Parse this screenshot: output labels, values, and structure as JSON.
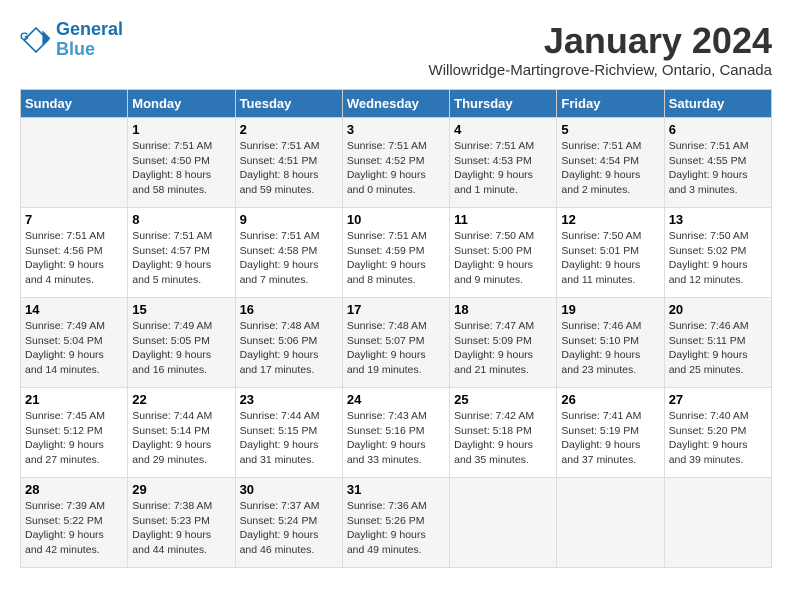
{
  "logo": {
    "line1": "General",
    "line2": "Blue"
  },
  "title": "January 2024",
  "subtitle": "Willowridge-Martingrove-Richview, Ontario, Canada",
  "days_of_week": [
    "Sunday",
    "Monday",
    "Tuesday",
    "Wednesday",
    "Thursday",
    "Friday",
    "Saturday"
  ],
  "weeks": [
    [
      {
        "day": "",
        "info": ""
      },
      {
        "day": "1",
        "info": "Sunrise: 7:51 AM\nSunset: 4:50 PM\nDaylight: 8 hours\nand 58 minutes."
      },
      {
        "day": "2",
        "info": "Sunrise: 7:51 AM\nSunset: 4:51 PM\nDaylight: 8 hours\nand 59 minutes."
      },
      {
        "day": "3",
        "info": "Sunrise: 7:51 AM\nSunset: 4:52 PM\nDaylight: 9 hours\nand 0 minutes."
      },
      {
        "day": "4",
        "info": "Sunrise: 7:51 AM\nSunset: 4:53 PM\nDaylight: 9 hours\nand 1 minute."
      },
      {
        "day": "5",
        "info": "Sunrise: 7:51 AM\nSunset: 4:54 PM\nDaylight: 9 hours\nand 2 minutes."
      },
      {
        "day": "6",
        "info": "Sunrise: 7:51 AM\nSunset: 4:55 PM\nDaylight: 9 hours\nand 3 minutes."
      }
    ],
    [
      {
        "day": "7",
        "info": "Sunrise: 7:51 AM\nSunset: 4:56 PM\nDaylight: 9 hours\nand 4 minutes."
      },
      {
        "day": "8",
        "info": "Sunrise: 7:51 AM\nSunset: 4:57 PM\nDaylight: 9 hours\nand 5 minutes."
      },
      {
        "day": "9",
        "info": "Sunrise: 7:51 AM\nSunset: 4:58 PM\nDaylight: 9 hours\nand 7 minutes."
      },
      {
        "day": "10",
        "info": "Sunrise: 7:51 AM\nSunset: 4:59 PM\nDaylight: 9 hours\nand 8 minutes."
      },
      {
        "day": "11",
        "info": "Sunrise: 7:50 AM\nSunset: 5:00 PM\nDaylight: 9 hours\nand 9 minutes."
      },
      {
        "day": "12",
        "info": "Sunrise: 7:50 AM\nSunset: 5:01 PM\nDaylight: 9 hours\nand 11 minutes."
      },
      {
        "day": "13",
        "info": "Sunrise: 7:50 AM\nSunset: 5:02 PM\nDaylight: 9 hours\nand 12 minutes."
      }
    ],
    [
      {
        "day": "14",
        "info": "Sunrise: 7:49 AM\nSunset: 5:04 PM\nDaylight: 9 hours\nand 14 minutes."
      },
      {
        "day": "15",
        "info": "Sunrise: 7:49 AM\nSunset: 5:05 PM\nDaylight: 9 hours\nand 16 minutes."
      },
      {
        "day": "16",
        "info": "Sunrise: 7:48 AM\nSunset: 5:06 PM\nDaylight: 9 hours\nand 17 minutes."
      },
      {
        "day": "17",
        "info": "Sunrise: 7:48 AM\nSunset: 5:07 PM\nDaylight: 9 hours\nand 19 minutes."
      },
      {
        "day": "18",
        "info": "Sunrise: 7:47 AM\nSunset: 5:09 PM\nDaylight: 9 hours\nand 21 minutes."
      },
      {
        "day": "19",
        "info": "Sunrise: 7:46 AM\nSunset: 5:10 PM\nDaylight: 9 hours\nand 23 minutes."
      },
      {
        "day": "20",
        "info": "Sunrise: 7:46 AM\nSunset: 5:11 PM\nDaylight: 9 hours\nand 25 minutes."
      }
    ],
    [
      {
        "day": "21",
        "info": "Sunrise: 7:45 AM\nSunset: 5:12 PM\nDaylight: 9 hours\nand 27 minutes."
      },
      {
        "day": "22",
        "info": "Sunrise: 7:44 AM\nSunset: 5:14 PM\nDaylight: 9 hours\nand 29 minutes."
      },
      {
        "day": "23",
        "info": "Sunrise: 7:44 AM\nSunset: 5:15 PM\nDaylight: 9 hours\nand 31 minutes."
      },
      {
        "day": "24",
        "info": "Sunrise: 7:43 AM\nSunset: 5:16 PM\nDaylight: 9 hours\nand 33 minutes."
      },
      {
        "day": "25",
        "info": "Sunrise: 7:42 AM\nSunset: 5:18 PM\nDaylight: 9 hours\nand 35 minutes."
      },
      {
        "day": "26",
        "info": "Sunrise: 7:41 AM\nSunset: 5:19 PM\nDaylight: 9 hours\nand 37 minutes."
      },
      {
        "day": "27",
        "info": "Sunrise: 7:40 AM\nSunset: 5:20 PM\nDaylight: 9 hours\nand 39 minutes."
      }
    ],
    [
      {
        "day": "28",
        "info": "Sunrise: 7:39 AM\nSunset: 5:22 PM\nDaylight: 9 hours\nand 42 minutes."
      },
      {
        "day": "29",
        "info": "Sunrise: 7:38 AM\nSunset: 5:23 PM\nDaylight: 9 hours\nand 44 minutes."
      },
      {
        "day": "30",
        "info": "Sunrise: 7:37 AM\nSunset: 5:24 PM\nDaylight: 9 hours\nand 46 minutes."
      },
      {
        "day": "31",
        "info": "Sunrise: 7:36 AM\nSunset: 5:26 PM\nDaylight: 9 hours\nand 49 minutes."
      },
      {
        "day": "",
        "info": ""
      },
      {
        "day": "",
        "info": ""
      },
      {
        "day": "",
        "info": ""
      }
    ]
  ]
}
